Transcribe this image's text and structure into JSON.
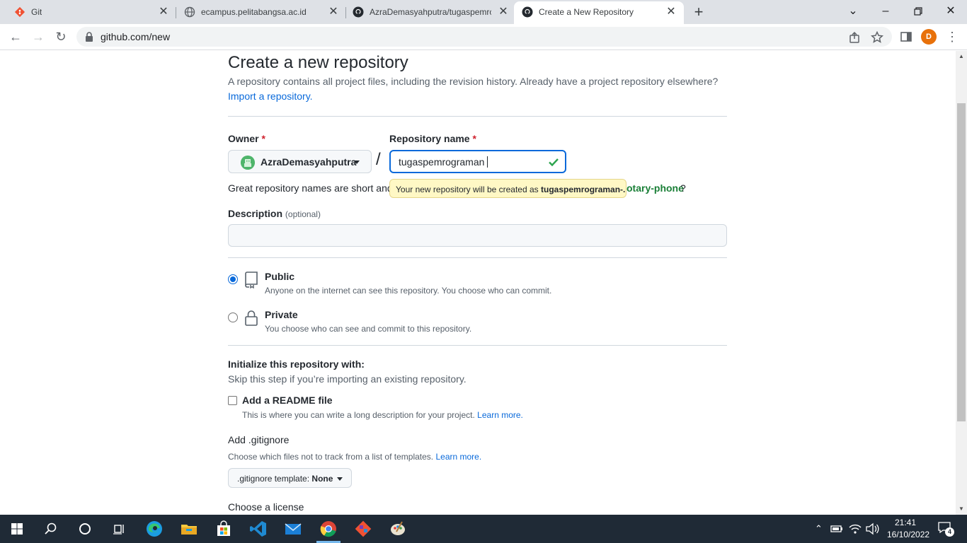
{
  "browser": {
    "tabs": [
      {
        "title": "Git",
        "icon": "git-icon",
        "active": false
      },
      {
        "title": "ecampus.pelitabangsa.ac.id",
        "icon": "globe-icon",
        "active": false
      },
      {
        "title": "AzraDemasyahputra/tugaspemrc",
        "icon": "github-icon",
        "active": false
      },
      {
        "title": "Create a New Repository",
        "icon": "github-icon",
        "active": true
      }
    ],
    "close_glyph": "✕",
    "new_tab_glyph": "+",
    "url": "github.com/new",
    "profile_initial": "D"
  },
  "page": {
    "title": "Create a new repository",
    "lead": "A repository contains all project files, including the revision history. Already have a project repository elsewhere?",
    "import_link": "Import a repository.",
    "owner_label": "Owner",
    "repo_label": "Repository name",
    "required_mark": "*",
    "owner_value": "AzraDemasyahputra",
    "slash": "/",
    "repo_value": "tugaspemrograman",
    "hint_prefix": "Great repository names are short and",
    "hint_suggestion": "otary-phone",
    "hint_suffix": "?",
    "tooltip_prefix": "Your new repository will be created as",
    "tooltip_name": "tugaspemrograman-.",
    "description_label": "Description",
    "description_optional": "(optional)",
    "description_value": "",
    "visibility": [
      {
        "title": "Public",
        "desc": "Anyone on the internet can see this repository. You choose who can commit.",
        "selected": true
      },
      {
        "title": "Private",
        "desc": "You choose who can see and commit to this repository.",
        "selected": false
      }
    ],
    "init_title": "Initialize this repository with:",
    "init_sub": "Skip this step if you’re importing an existing repository.",
    "readme_label": "Add a README file",
    "readme_note": "This is where you can write a long description for your project.",
    "learn_more": "Learn more.",
    "gitignore_title": "Add .gitignore",
    "gitignore_note": "Choose which files not to track from a list of templates.",
    "gitignore_btn_prefix": ".gitignore template:",
    "gitignore_btn_value": "None",
    "license_title": "Choose a license"
  },
  "taskbar": {
    "apps": [
      "windows-start",
      "search",
      "cortana",
      "task-view",
      "edge",
      "file-explorer",
      "microsoft-store",
      "vs-code",
      "mail",
      "chrome",
      "git-gui",
      "paint"
    ],
    "time": "21:41",
    "date": "16/10/2022",
    "notifications": "4"
  },
  "colors": {
    "accent": "#0969da",
    "success": "#1a7f37",
    "tooltip_bg": "#fff8c5",
    "taskbar": "#1f2a36"
  }
}
